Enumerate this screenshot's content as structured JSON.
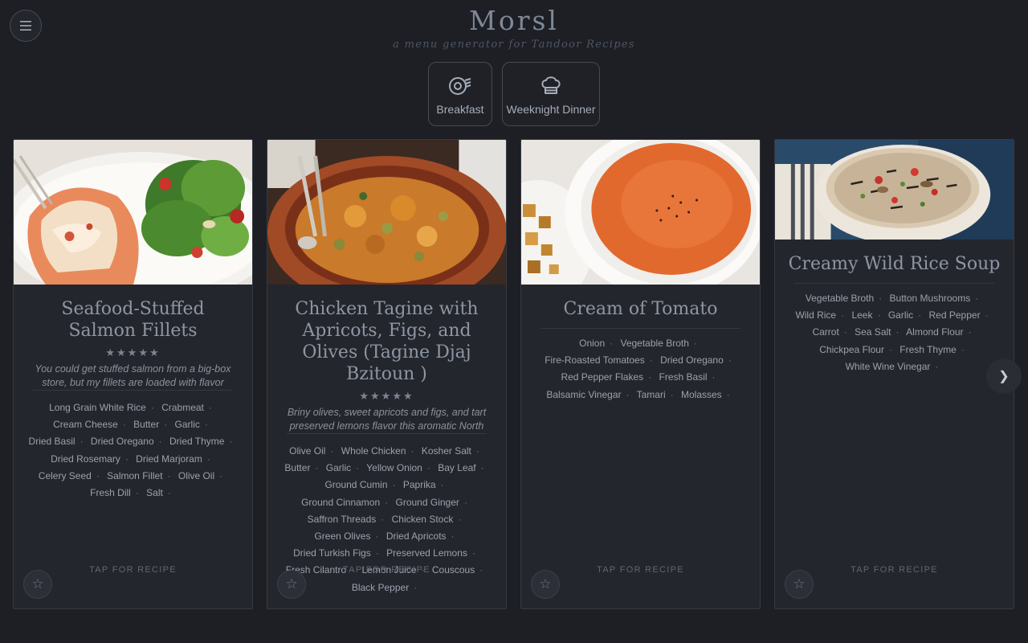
{
  "header": {
    "title": "Morsl",
    "subtitle": "a menu generator for Tandoor Recipes",
    "menu_icon": "hamburger-icon"
  },
  "menus": [
    {
      "label": "Breakfast",
      "icon": "egg-pan-icon"
    },
    {
      "label": "Weeknight Dinner",
      "icon": "chef-hat-icon"
    }
  ],
  "cards": [
    {
      "title": "Seafood-Stuffed Salmon Fillets",
      "rating": "★★★★★",
      "description": "You could get stuffed salmon from a big-box store, but my fillets are loaded with flavor",
      "ingredients": [
        "Long Grain White Rice",
        "Crabmeat",
        "Cream Cheese",
        "Butter",
        "Garlic",
        "Dried Basil",
        "Dried Oregano",
        "Dried Thyme",
        "Dried Rosemary",
        "Dried Marjoram",
        "Celery Seed",
        "Salmon Fillet",
        "Olive Oil",
        "Fresh Dill",
        "Salt"
      ],
      "cta": "TAP FOR RECIPE",
      "fav_icon": "star-outline-icon"
    },
    {
      "title": "Chicken Tagine with Apricots, Figs, and Olives (Tagine Djaj Bzitoun )",
      "rating": "★★★★★",
      "description": "Briny olives, sweet apricots and figs, and tart preserved lemons flavor this aromatic North",
      "ingredients": [
        "Olive Oil",
        "Whole Chicken",
        "Kosher Salt",
        "Butter",
        "Garlic",
        "Yellow Onion",
        "Bay Leaf",
        "Ground Cumin",
        "Paprika",
        "Ground Cinnamon",
        "Ground Ginger",
        "Saffron Threads",
        "Chicken Stock",
        "Green Olives",
        "Dried Apricots",
        "Dried Turkish Figs",
        "Preserved Lemons",
        "Fresh Cilantro",
        "Lemon Juice",
        "Couscous",
        "Black Pepper"
      ],
      "cta": "TAP FOR RECIPE",
      "fav_icon": "star-outline-icon"
    },
    {
      "title": "Cream of Tomato",
      "ingredients": [
        "Onion",
        "Vegetable Broth",
        "Fire-Roasted Tomatoes",
        "Dried Oregano",
        "Red Pepper Flakes",
        "Fresh Basil",
        "Balsamic Vinegar",
        "Tamari",
        "Molasses"
      ],
      "cta": "TAP FOR RECIPE",
      "fav_icon": "star-outline-icon"
    },
    {
      "title": "Creamy Wild Rice Soup",
      "ingredients": [
        "Vegetable Broth",
        "Button Mushrooms",
        "Wild Rice",
        "Leek",
        "Garlic",
        "Red Pepper",
        "Carrot",
        "Sea Salt",
        "Almond Flour",
        "Chickpea Flour",
        "Fresh Thyme",
        "White Wine Vinegar"
      ],
      "cta": "TAP FOR RECIPE",
      "fav_icon": "star-outline-icon"
    }
  ],
  "carousel": {
    "next_glyph": "❯",
    "next_icon": "chevron-right-icon"
  }
}
